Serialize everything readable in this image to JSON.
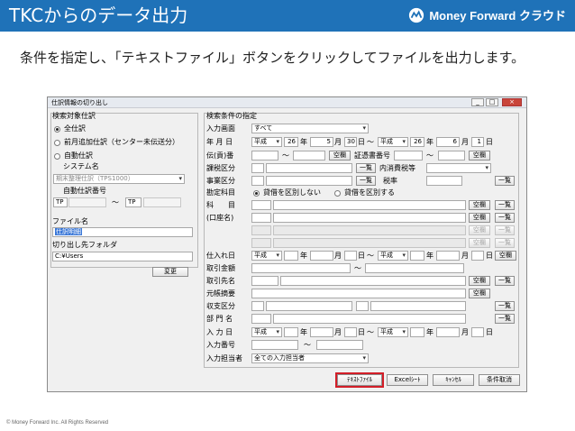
{
  "slide": {
    "title": "TKCからのデータ出力",
    "brand": "Money Forward クラウド",
    "caption": "条件を指定し、「テキストファイル」ボタンをクリックしてファイルを出力します。",
    "footer": "© Money Forward Inc. All Rights Reserved",
    "colors": {
      "header": "#1f72b8",
      "highlight": "#d21e28"
    }
  },
  "window": {
    "title": "仕訳情報の切り出し",
    "left": {
      "group_title": "検索対象仕訳",
      "radio_all": "全仕訳",
      "radio_prev": "前月追加仕訳（センター未伝送分）",
      "radio_auto": "自動仕訳",
      "system_label": "システム名",
      "system_value": "期末整理仕訳（TPS1000）",
      "auto_no_label": "自動仕訳番号",
      "auto_from": "TP",
      "auto_tilde": "～",
      "auto_to": "TP",
      "file_label": "ファイル名",
      "file_value": "仕訳明細",
      "folder_label": "切り出し先フォルダ",
      "folder_value": "C:¥Users",
      "change_button": "変更"
    },
    "right": {
      "group_title": "検索条件の指定",
      "input_screen_label": "入力画面",
      "input_screen_value": "すべて",
      "date_label": "年 月 日",
      "era1": "平成",
      "y1": "26",
      "y_unit": "年",
      "m1": "5",
      "m_unit": "月",
      "d1": "30",
      "d_unit": "日",
      "tilde": "～",
      "era2": "平成",
      "y2": "26",
      "m2": "6",
      "d2": "1",
      "denpyo_label": "伝(貢)番",
      "blank_button": "空欄",
      "shoko_label": "証憑書番号",
      "kazei_label": "課税区分",
      "list_button": "一覧",
      "uchi_label": "内消費税等",
      "jigyo_label": "事業区分",
      "zeiritsu_label": "税率",
      "kanjo_label": "勘定科目",
      "radio_no_split": "貸借を区別しない",
      "radio_split": "貸借を区別する",
      "kamoku_label": "科　　目",
      "kouza_label": "(口座名)",
      "shiire_label": "仕入れ日",
      "torihiki_kingaku_label": "取引金額",
      "torihikisaki_label": "取引先名",
      "motochou_label": "元帳摘要",
      "shushi_label": "収支区分",
      "bumon_label": "部 門 名",
      "nyuryoku_date_label": "入 力 日",
      "nyuryoku_no_label": "入力番号",
      "tantou_label": "入力担当者",
      "tantou_value": "全ての入力担当者"
    },
    "buttons": {
      "text_file": "ﾃｷｽﾄﾌｧｲﾙ",
      "excel": "Excelｼｰﾄ",
      "cancel": "ｷｬﾝｾﾙ",
      "condition_cancel": "条件取消"
    }
  }
}
